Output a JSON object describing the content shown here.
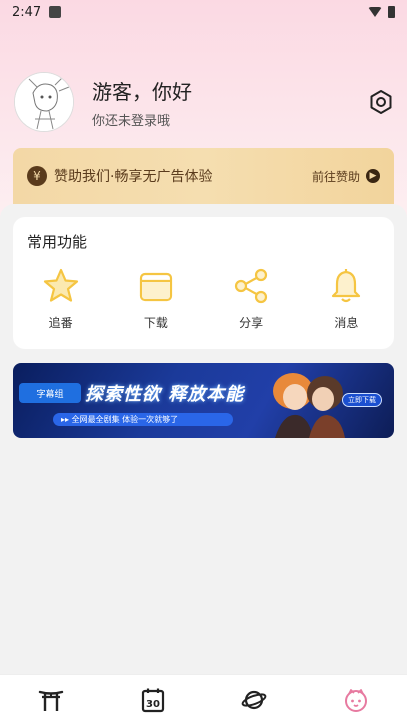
{
  "status_bar": {
    "time": "2:47"
  },
  "profile": {
    "name": "游客，你好",
    "subtitle": "你还未登录哦"
  },
  "sponsor": {
    "yen_symbol": "¥",
    "text": "赞助我们·畅享无广告体验",
    "action": "前往赞助"
  },
  "functions": {
    "title": "常用功能",
    "items": [
      {
        "label": "追番",
        "icon": "star-icon"
      },
      {
        "label": "下载",
        "icon": "folder-icon"
      },
      {
        "label": "分享",
        "icon": "share-icon"
      },
      {
        "label": "消息",
        "icon": "bell-icon"
      }
    ]
  },
  "banner": {
    "logo_text": "字幕组",
    "headline": "探索性欲 释放本能",
    "strip_text": "▸▸ 全网最全剧集 体验一次就够了",
    "button": "立即下载"
  },
  "bottom_nav": {
    "items": [
      {
        "icon": "torii-gate-icon"
      },
      {
        "icon": "calendar-icon",
        "number": "30"
      },
      {
        "icon": "planet-icon"
      },
      {
        "icon": "mascot-face-icon"
      }
    ]
  },
  "colors": {
    "accent_yellow": "#f5c542",
    "sponsor_brown": "#5a3b1c",
    "active_pink": "#e77aa0"
  }
}
